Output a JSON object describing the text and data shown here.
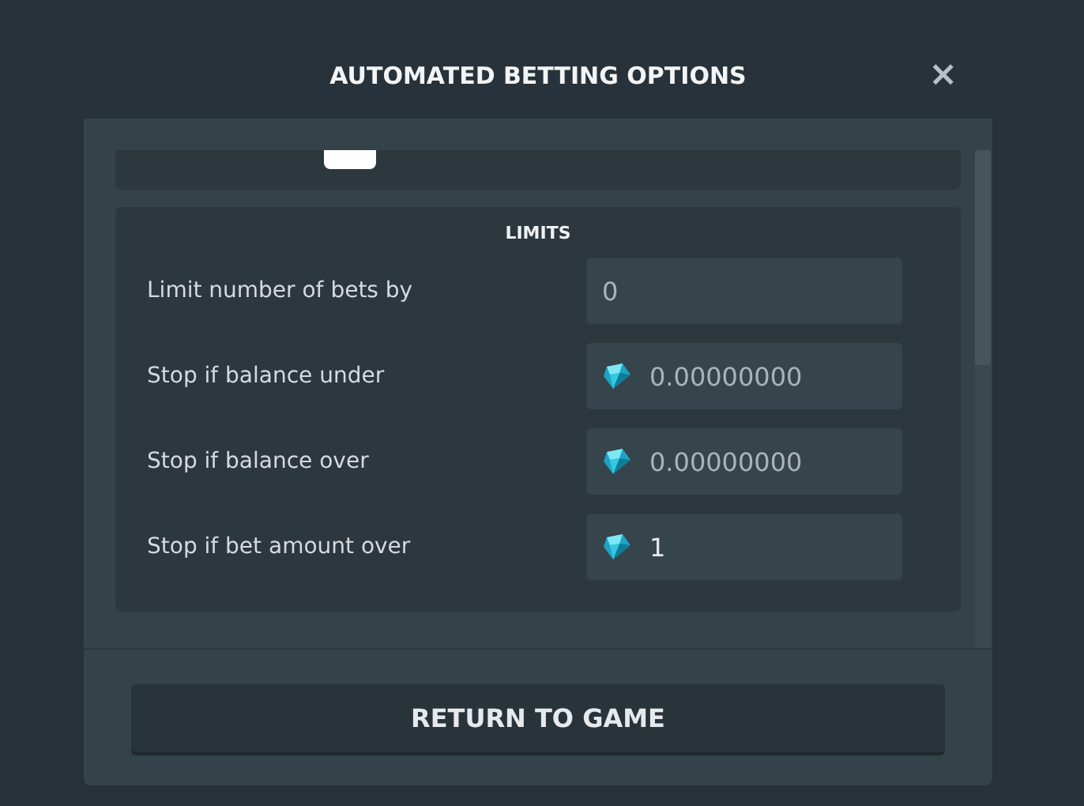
{
  "dialog": {
    "title": "AUTOMATED BETTING OPTIONS",
    "close": "×"
  },
  "limits": {
    "heading": "LIMITS",
    "rows": [
      {
        "label": "Limit number of bets by",
        "kind": "plain",
        "placeholder": "0"
      },
      {
        "label": "Stop if balance under",
        "kind": "currency",
        "placeholder": "0.00000000"
      },
      {
        "label": "Stop if balance over",
        "kind": "currency",
        "placeholder": "0.00000000"
      },
      {
        "label": "Stop if bet amount over",
        "kind": "currency",
        "value": "1"
      }
    ]
  },
  "footer": {
    "button": "RETURN TO GAME"
  }
}
